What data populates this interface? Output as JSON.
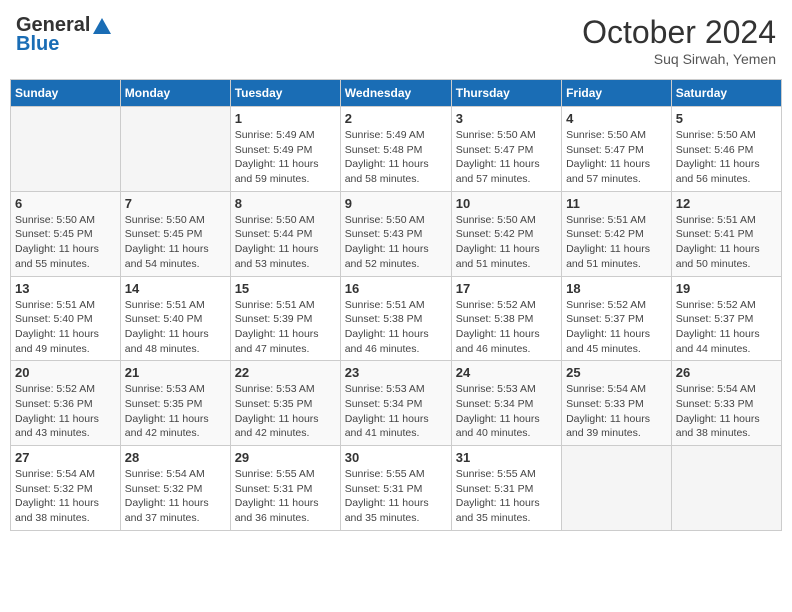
{
  "header": {
    "logo_general": "General",
    "logo_blue": "Blue",
    "month_title": "October 2024",
    "subtitle": "Suq Sirwah, Yemen"
  },
  "weekdays": [
    "Sunday",
    "Monday",
    "Tuesday",
    "Wednesday",
    "Thursday",
    "Friday",
    "Saturday"
  ],
  "weeks": [
    [
      {
        "day": "",
        "sunrise": "",
        "sunset": "",
        "daylight": ""
      },
      {
        "day": "",
        "sunrise": "",
        "sunset": "",
        "daylight": ""
      },
      {
        "day": "1",
        "sunrise": "Sunrise: 5:49 AM",
        "sunset": "Sunset: 5:49 PM",
        "daylight": "Daylight: 11 hours and 59 minutes."
      },
      {
        "day": "2",
        "sunrise": "Sunrise: 5:49 AM",
        "sunset": "Sunset: 5:48 PM",
        "daylight": "Daylight: 11 hours and 58 minutes."
      },
      {
        "day": "3",
        "sunrise": "Sunrise: 5:50 AM",
        "sunset": "Sunset: 5:47 PM",
        "daylight": "Daylight: 11 hours and 57 minutes."
      },
      {
        "day": "4",
        "sunrise": "Sunrise: 5:50 AM",
        "sunset": "Sunset: 5:47 PM",
        "daylight": "Daylight: 11 hours and 57 minutes."
      },
      {
        "day": "5",
        "sunrise": "Sunrise: 5:50 AM",
        "sunset": "Sunset: 5:46 PM",
        "daylight": "Daylight: 11 hours and 56 minutes."
      }
    ],
    [
      {
        "day": "6",
        "sunrise": "Sunrise: 5:50 AM",
        "sunset": "Sunset: 5:45 PM",
        "daylight": "Daylight: 11 hours and 55 minutes."
      },
      {
        "day": "7",
        "sunrise": "Sunrise: 5:50 AM",
        "sunset": "Sunset: 5:45 PM",
        "daylight": "Daylight: 11 hours and 54 minutes."
      },
      {
        "day": "8",
        "sunrise": "Sunrise: 5:50 AM",
        "sunset": "Sunset: 5:44 PM",
        "daylight": "Daylight: 11 hours and 53 minutes."
      },
      {
        "day": "9",
        "sunrise": "Sunrise: 5:50 AM",
        "sunset": "Sunset: 5:43 PM",
        "daylight": "Daylight: 11 hours and 52 minutes."
      },
      {
        "day": "10",
        "sunrise": "Sunrise: 5:50 AM",
        "sunset": "Sunset: 5:42 PM",
        "daylight": "Daylight: 11 hours and 51 minutes."
      },
      {
        "day": "11",
        "sunrise": "Sunrise: 5:51 AM",
        "sunset": "Sunset: 5:42 PM",
        "daylight": "Daylight: 11 hours and 51 minutes."
      },
      {
        "day": "12",
        "sunrise": "Sunrise: 5:51 AM",
        "sunset": "Sunset: 5:41 PM",
        "daylight": "Daylight: 11 hours and 50 minutes."
      }
    ],
    [
      {
        "day": "13",
        "sunrise": "Sunrise: 5:51 AM",
        "sunset": "Sunset: 5:40 PM",
        "daylight": "Daylight: 11 hours and 49 minutes."
      },
      {
        "day": "14",
        "sunrise": "Sunrise: 5:51 AM",
        "sunset": "Sunset: 5:40 PM",
        "daylight": "Daylight: 11 hours and 48 minutes."
      },
      {
        "day": "15",
        "sunrise": "Sunrise: 5:51 AM",
        "sunset": "Sunset: 5:39 PM",
        "daylight": "Daylight: 11 hours and 47 minutes."
      },
      {
        "day": "16",
        "sunrise": "Sunrise: 5:51 AM",
        "sunset": "Sunset: 5:38 PM",
        "daylight": "Daylight: 11 hours and 46 minutes."
      },
      {
        "day": "17",
        "sunrise": "Sunrise: 5:52 AM",
        "sunset": "Sunset: 5:38 PM",
        "daylight": "Daylight: 11 hours and 46 minutes."
      },
      {
        "day": "18",
        "sunrise": "Sunrise: 5:52 AM",
        "sunset": "Sunset: 5:37 PM",
        "daylight": "Daylight: 11 hours and 45 minutes."
      },
      {
        "day": "19",
        "sunrise": "Sunrise: 5:52 AM",
        "sunset": "Sunset: 5:37 PM",
        "daylight": "Daylight: 11 hours and 44 minutes."
      }
    ],
    [
      {
        "day": "20",
        "sunrise": "Sunrise: 5:52 AM",
        "sunset": "Sunset: 5:36 PM",
        "daylight": "Daylight: 11 hours and 43 minutes."
      },
      {
        "day": "21",
        "sunrise": "Sunrise: 5:53 AM",
        "sunset": "Sunset: 5:35 PM",
        "daylight": "Daylight: 11 hours and 42 minutes."
      },
      {
        "day": "22",
        "sunrise": "Sunrise: 5:53 AM",
        "sunset": "Sunset: 5:35 PM",
        "daylight": "Daylight: 11 hours and 42 minutes."
      },
      {
        "day": "23",
        "sunrise": "Sunrise: 5:53 AM",
        "sunset": "Sunset: 5:34 PM",
        "daylight": "Daylight: 11 hours and 41 minutes."
      },
      {
        "day": "24",
        "sunrise": "Sunrise: 5:53 AM",
        "sunset": "Sunset: 5:34 PM",
        "daylight": "Daylight: 11 hours and 40 minutes."
      },
      {
        "day": "25",
        "sunrise": "Sunrise: 5:54 AM",
        "sunset": "Sunset: 5:33 PM",
        "daylight": "Daylight: 11 hours and 39 minutes."
      },
      {
        "day": "26",
        "sunrise": "Sunrise: 5:54 AM",
        "sunset": "Sunset: 5:33 PM",
        "daylight": "Daylight: 11 hours and 38 minutes."
      }
    ],
    [
      {
        "day": "27",
        "sunrise": "Sunrise: 5:54 AM",
        "sunset": "Sunset: 5:32 PM",
        "daylight": "Daylight: 11 hours and 38 minutes."
      },
      {
        "day": "28",
        "sunrise": "Sunrise: 5:54 AM",
        "sunset": "Sunset: 5:32 PM",
        "daylight": "Daylight: 11 hours and 37 minutes."
      },
      {
        "day": "29",
        "sunrise": "Sunrise: 5:55 AM",
        "sunset": "Sunset: 5:31 PM",
        "daylight": "Daylight: 11 hours and 36 minutes."
      },
      {
        "day": "30",
        "sunrise": "Sunrise: 5:55 AM",
        "sunset": "Sunset: 5:31 PM",
        "daylight": "Daylight: 11 hours and 35 minutes."
      },
      {
        "day": "31",
        "sunrise": "Sunrise: 5:55 AM",
        "sunset": "Sunset: 5:31 PM",
        "daylight": "Daylight: 11 hours and 35 minutes."
      },
      {
        "day": "",
        "sunrise": "",
        "sunset": "",
        "daylight": ""
      },
      {
        "day": "",
        "sunrise": "",
        "sunset": "",
        "daylight": ""
      }
    ]
  ]
}
